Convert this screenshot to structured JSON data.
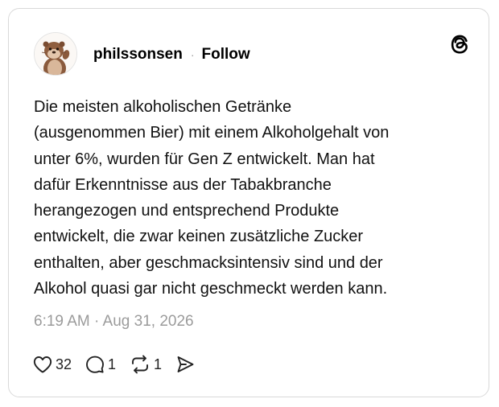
{
  "post": {
    "username": "philssonsen",
    "separator": "·",
    "follow_label": "Follow",
    "text": "Die meisten alkoholischen Getränke\n(ausgenommen Bier) mit einem Alkoholgehalt von\nunter 6%, wurden für Gen Z entwickelt. Man hat\ndafür Erkenntnisse aus der Tabakbranche\nherangezogen und entsprechend Produkte\nentwickelt, die zwar keinen zusätzliche Zucker\nenthalten, aber geschmacksintensiv sind und der\nAlkohol quasi gar nicht geschmeckt werden kann.",
    "timestamp": "6:19 AM · Aug 31, 2026"
  },
  "actions": {
    "like_icon": "heart-icon",
    "like_count": "32",
    "reply_icon": "comment-icon",
    "reply_count": "1",
    "repost_icon": "repost-icon",
    "repost_count": "1",
    "share_icon": "send-icon"
  },
  "brand": {
    "logo_icon": "threads-logo-icon"
  },
  "colors": {
    "border": "#d9d9d9",
    "muted_text": "#9b9b9b",
    "text": "#111111"
  }
}
